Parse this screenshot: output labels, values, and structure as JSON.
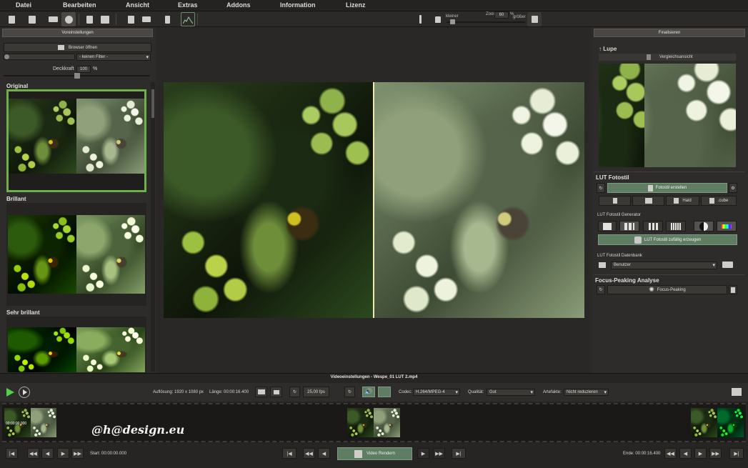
{
  "menu": [
    "Datei",
    "Bearbeiten",
    "Ansicht",
    "Extras",
    "Addons",
    "Information",
    "Lizenz"
  ],
  "toolbar": {
    "zoom": {
      "smaller_label": "kleiner",
      "zoom_label": "Zoom",
      "value": "60",
      "unit": "%",
      "bigger_label": "größer"
    }
  },
  "left_panel": {
    "header": "Voreinstellungen",
    "browser_button": "Browser öffnen",
    "filter_select": "- keinen Filter -",
    "opacity_label": "Deckkraft",
    "opacity_value": "100",
    "opacity_unit": "%",
    "opacity_level": 1.0,
    "presets": [
      {
        "label": "Original",
        "selected": true
      },
      {
        "label": "Brillant",
        "selected": false
      },
      {
        "label": "Sehr brillant",
        "selected": false
      }
    ]
  },
  "right_panel": {
    "header": "Finalisieren",
    "lupe_title": "Lupe",
    "compare_label": "Vergleichsansicht",
    "lut_title": "LUT Fotostil",
    "create_style_button": "Fotostil erstellen",
    "hald_label": "Hald",
    "cube_label": ".cube",
    "generator_label": "LUT Fotostil Generator",
    "random_button": "LUT Fotostil zufällig erzeugen",
    "database_label": "LUT Fotostil Datenbank",
    "database_select": "Benutzer",
    "focus_title": "Focus-Peaking Analyse",
    "focus_button": "Focus-Peaking"
  },
  "video_settings": {
    "title": "Videoeinstellungen - Wespe_01 LUT 2.mp4",
    "resolution": "Auflösung: 1920 x 1080 px",
    "length": "Länge: 00:00:16.400",
    "fps": "25,00 fps",
    "codec_label": "Codec:",
    "codec_value": "H.264/MPEG-4",
    "quality_label": "Qualität:",
    "quality_value": "Gut",
    "artifacts_label": "Artefakte:",
    "artifacts_value": "Nicht reduzieren"
  },
  "timeline": {
    "first_clip_time": "00:00:00.000",
    "watermark": "@h@design.eu",
    "start_label": "Start: 00:00:00.000",
    "end_label": "Ende: 00:00:16.400",
    "render_button": "Video Rendern"
  },
  "colors": {
    "accent_green": "#6fb04a",
    "render_green": "#5e7d62",
    "background": "#2b2927"
  }
}
